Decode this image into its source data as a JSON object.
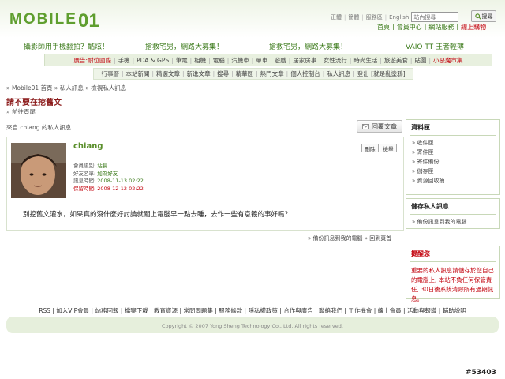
{
  "header": {
    "logo_text": "MOBILE",
    "logo_number": "01",
    "top_links": [
      "正體",
      "簡體",
      "服務區",
      "English"
    ],
    "search_placeholder": "站內搜尋",
    "search_button": "搜尋",
    "user_links": [
      "首頁",
      "會員中心",
      "網站服務",
      "線上購物"
    ]
  },
  "ad_row": {
    "items": [
      "攝影師用手機翻拍？酷炫！",
      "搶救宅男，網路大募集！",
      "搶救宅男，網路大募集！",
      "VAIO TT 王者輕薄"
    ]
  },
  "nav1": {
    "items": [
      "廣告:耐位國際",
      "手機",
      "PDA & GPS",
      "筆電",
      "相機",
      "電腦",
      "汽機車",
      "單車",
      "遊戲",
      "居家房事",
      "女性流行",
      "時尚生活",
      "旅遊美食",
      "貼圖",
      "小惡魔市集"
    ]
  },
  "nav2": {
    "items": [
      "行事曆",
      "本站新聞",
      "精選文章",
      "新進文章",
      "搜尋",
      "精華區",
      "熱門文章",
      "個人控制台",
      "私人訊息",
      "登出 [就是亂塗鴉]"
    ]
  },
  "breadcrumb": "» Mobile01 首頁 » 私人訊息 » 檢視私人訊息",
  "page_title": "請不要在挖舊文",
  "latest_link": "» 前往頁尾",
  "message": {
    "from_line": "來自 chiang 的私人訊息",
    "reply_button": "回覆文章",
    "sender": "chiang",
    "delete_button": "刪除",
    "report_button": "檢舉",
    "details": [
      {
        "label": "會員級別:",
        "value": "站長",
        "style": "val"
      },
      {
        "label": "好友名單:",
        "value": "加為好友",
        "style": "val"
      },
      {
        "label": "訊息時間:",
        "value": "2008-11-13 02:22",
        "style": "val"
      },
      {
        "label": "保留時間:",
        "value": "2008-12-12 02:22",
        "style": "red"
      }
    ],
    "body": "別挖舊文灌水，如果真的沒什麼好討論就關上電腦早一點去睡，去作一些有意義的事好嗎？",
    "bottom_links": "» 備份訊息到我的電腦 » 回到頁首"
  },
  "sidebar": {
    "folders_title": "資料匣",
    "folders": [
      "» 收件匣",
      "» 寄件匣",
      "» 寄件備份",
      "» 儲存匣",
      "» 資源回收桶"
    ],
    "backup_title": "儲存私人訊息",
    "backup_link": "» 備份訊息到我的電腦",
    "notice_title": "提醒您",
    "notice_text": "重要的私人訊息請儲存於您自己的電腦上, 本站不負任何保管責任, 30日後系統清除所有過期訊息。"
  },
  "footer": {
    "links": "RSS | 加入VIP會員 | 站務回報 | 檔案下載 | 教育資源 | 常問問題集 | 服務條款 | 隱私權政策 | 合作與廣告 | 聯絡我們 | 工作機會 | 線上會員 | 活動與報導 | 輔助說明",
    "copyright": "Copyright © 2007 Yong Sheng Technology Co., Ltd. All rights reserved."
  },
  "watermark": "#53403",
  "colors": {
    "green": "#5f9e2f",
    "red": "#c2000b",
    "nav_bg": "#e8f0df"
  }
}
